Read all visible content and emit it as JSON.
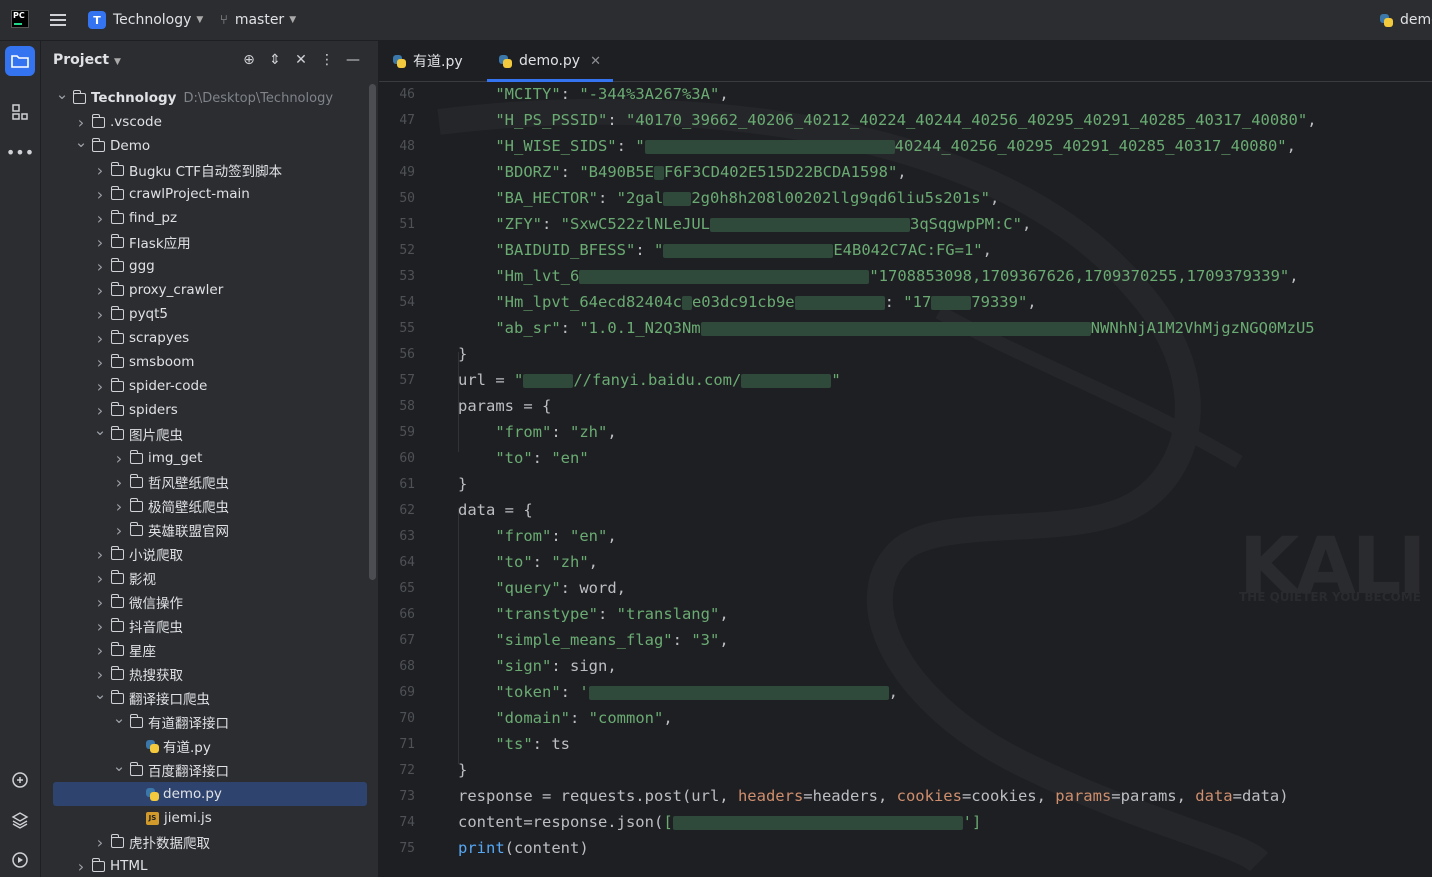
{
  "titlebar": {
    "project_initial": "T",
    "project_name": "Technology",
    "branch": "master",
    "run_config": "demo"
  },
  "panel": {
    "title": "Project",
    "tree": [
      {
        "label": "Technology",
        "path": "D:\\Desktop\\Technology",
        "arrow": "open",
        "depth": 0,
        "type": "folder",
        "bold": true
      },
      {
        "label": ".vscode",
        "arrow": "closed",
        "depth": 1,
        "type": "folder"
      },
      {
        "label": "Demo",
        "arrow": "open",
        "depth": 1,
        "type": "folder"
      },
      {
        "label": "Bugku CTF自动签到脚本",
        "arrow": "closed",
        "depth": 2,
        "type": "folder"
      },
      {
        "label": "crawlProject-main",
        "arrow": "closed",
        "depth": 2,
        "type": "folder"
      },
      {
        "label": "find_pz",
        "arrow": "closed",
        "depth": 2,
        "type": "folder"
      },
      {
        "label": "Flask应用",
        "arrow": "closed",
        "depth": 2,
        "type": "folder"
      },
      {
        "label": "ggg",
        "arrow": "closed",
        "depth": 2,
        "type": "folder"
      },
      {
        "label": "proxy_crawler",
        "arrow": "closed",
        "depth": 2,
        "type": "folder"
      },
      {
        "label": "pyqt5",
        "arrow": "closed",
        "depth": 2,
        "type": "folder"
      },
      {
        "label": "scrapyes",
        "arrow": "closed",
        "depth": 2,
        "type": "folder"
      },
      {
        "label": "smsboom",
        "arrow": "closed",
        "depth": 2,
        "type": "folder"
      },
      {
        "label": "spider-code",
        "arrow": "closed",
        "depth": 2,
        "type": "folder"
      },
      {
        "label": "spiders",
        "arrow": "closed",
        "depth": 2,
        "type": "folder"
      },
      {
        "label": "图片爬虫",
        "arrow": "open",
        "depth": 2,
        "type": "folder"
      },
      {
        "label": "img_get",
        "arrow": "closed",
        "depth": 3,
        "type": "folder"
      },
      {
        "label": "哲风壁纸爬虫",
        "arrow": "closed",
        "depth": 3,
        "type": "folder"
      },
      {
        "label": "极简壁纸爬虫",
        "arrow": "closed",
        "depth": 3,
        "type": "folder"
      },
      {
        "label": "英雄联盟官网",
        "arrow": "closed",
        "depth": 3,
        "type": "folder"
      },
      {
        "label": "小说爬取",
        "arrow": "closed",
        "depth": 2,
        "type": "folder"
      },
      {
        "label": "影视",
        "arrow": "closed",
        "depth": 2,
        "type": "folder"
      },
      {
        "label": "微信操作",
        "arrow": "closed",
        "depth": 2,
        "type": "folder"
      },
      {
        "label": "抖音爬虫",
        "arrow": "closed",
        "depth": 2,
        "type": "folder"
      },
      {
        "label": "星座",
        "arrow": "closed",
        "depth": 2,
        "type": "folder"
      },
      {
        "label": "热搜获取",
        "arrow": "closed",
        "depth": 2,
        "type": "folder"
      },
      {
        "label": "翻译接口爬虫",
        "arrow": "open",
        "depth": 2,
        "type": "folder"
      },
      {
        "label": "有道翻译接口",
        "arrow": "open",
        "depth": 3,
        "type": "folder"
      },
      {
        "label": "有道.py",
        "arrow": "none",
        "depth": 4,
        "type": "py"
      },
      {
        "label": "百度翻译接口",
        "arrow": "open",
        "depth": 3,
        "type": "folder"
      },
      {
        "label": "demo.py",
        "arrow": "none",
        "depth": 4,
        "type": "py",
        "selected": true
      },
      {
        "label": "jiemi.js",
        "arrow": "none",
        "depth": 4,
        "type": "js"
      },
      {
        "label": "虎扑数据爬取",
        "arrow": "closed",
        "depth": 2,
        "type": "folder"
      },
      {
        "label": "HTML",
        "arrow": "closed",
        "depth": 1,
        "type": "folder"
      }
    ]
  },
  "tabs": [
    {
      "label": "有道.py",
      "active": false
    },
    {
      "label": "demo.py",
      "active": true
    }
  ],
  "watermark": {
    "logo": "KALI",
    "tagline": "THE QUIETER YOU BECOME"
  },
  "code": [
    {
      "n": "46",
      "html": "    <span class='s'>\"MCITY\"</span>: <span class='s'>\"-344%3A267%3A\"</span>,"
    },
    {
      "n": "47",
      "html": "    <span class='s'>\"H_PS_PSSID\"</span>: <span class='s'>\"40170_39662_40206_40212_40224_40244_40256_40295_40291_40285_40317_40080\"</span>,"
    },
    {
      "n": "48",
      "html": "    <span class='s'>\"H_WISE_SIDS\"</span>: <span class='s'>\"</span><span class='blur' style='width:250px'></span><span class='s'>40244_40256_40295_40291_40285_40317_40080\"</span>,"
    },
    {
      "n": "49",
      "html": "    <span class='s'>\"BDORZ\"</span>: <span class='s'>\"B490B5E</span><span class='blur' style='width:10px'></span><span class='s'>F6F3CD402E515D22BCDA1598\"</span>,"
    },
    {
      "n": "50",
      "html": "    <span class='s'>\"BA_HECTOR\"</span>: <span class='s'>\"2gal</span><span class='blur' style='width:28px'></span><span class='s'>2g0h8h208l00202llg9qd6liu5s201s\"</span>,"
    },
    {
      "n": "51",
      "html": "    <span class='s'>\"ZFY\"</span>: <span class='s'>\"SxwC522zlNLeJUL</span><span class='blur' style='width:200px'></span><span class='s'>3qSqgwpPM:C\"</span>,"
    },
    {
      "n": "52",
      "html": "    <span class='s'>\"BAIDUID_BFESS\"</span>: <span class='s'>\"</span><span class='blur' style='width:170px'></span><span class='s'>E4B042C7AC:FG=1\"</span>,"
    },
    {
      "n": "53",
      "html": "    <span class='s'>\"Hm_lvt_6</span><span class='blur' style='width:290px'></span><span class='s'>\"1708853098,1709367626,1709370255,1709379339\"</span>,"
    },
    {
      "n": "54",
      "html": "    <span class='s'>\"Hm_lpvt_64ecd82404c</span><span class='blur' style='width:10px'></span><span class='s'>e03dc91cb9e</span><span class='blur' style='width:90px'></span>: <span class='s'>\"17</span><span class='blur' style='width:40px'></span><span class='s'>79339\"</span>,"
    },
    {
      "n": "55",
      "html": "    <span class='s'>\"ab_sr\"</span>: <span class='s'>\"1.0.1_N2Q3Nm</span><span class='blur' style='width:390px'></span><span class='s'>NWNhNjA1M2VhMjgzNGQ0MzU5</span>"
    },
    {
      "n": "56",
      "html": "}"
    },
    {
      "n": "57",
      "html": "url = <span class='s'>\"</span><span class='blur' style='width:50px'></span><span class='s'>//fanyi.baidu.com/</span><span class='blur' style='width:90px'></span><span class='s'>\"</span>"
    },
    {
      "n": "58",
      "html": "params = {"
    },
    {
      "n": "59",
      "html": "    <span class='s'>\"from\"</span>: <span class='s'>\"zh\"</span>,"
    },
    {
      "n": "60",
      "html": "    <span class='s'>\"to\"</span>: <span class='s'>\"en\"</span>"
    },
    {
      "n": "61",
      "html": "}"
    },
    {
      "n": "62",
      "html": "data = {"
    },
    {
      "n": "63",
      "html": "    <span class='s'>\"from\"</span>: <span class='s'>\"en\"</span>,"
    },
    {
      "n": "64",
      "html": "    <span class='s'>\"to\"</span>: <span class='s'>\"zh\"</span>,"
    },
    {
      "n": "65",
      "html": "    <span class='s'>\"query\"</span>: word,"
    },
    {
      "n": "66",
      "html": "    <span class='s'>\"transtype\"</span>: <span class='s'>\"translang\"</span>,"
    },
    {
      "n": "67",
      "html": "    <span class='s'>\"simple_means_flag\"</span>: <span class='s'>\"3\"</span>,"
    },
    {
      "n": "68",
      "html": "    <span class='s'>\"sign\"</span>: sign,"
    },
    {
      "n": "69",
      "html": "    <span class='s'>\"token\"</span>: <span class='s'>'</span><span class='blur' style='width:300px'></span>,"
    },
    {
      "n": "70",
      "html": "    <span class='s'>\"domain\"</span>: <span class='s'>\"common\"</span>,"
    },
    {
      "n": "71",
      "html": "    <span class='s'>\"ts\"</span>: ts"
    },
    {
      "n": "72",
      "html": "}"
    },
    {
      "n": "73",
      "html": "response = requests.post(url, <span class='kw'>headers</span>=headers, <span class='kw'>cookies</span>=cookies, <span class='kw'>params</span>=params, <span class='kw'>data</span>=data)"
    },
    {
      "n": "74",
      "html": "content=response.json(<span class='s'>[</span><span class='blur' style='width:290px'></span><span class='s'>']</span>"
    },
    {
      "n": "75",
      "html": "<span class='fn'>print</span>(content)"
    }
  ],
  "colors": {
    "accent": "#3574f0",
    "string": "#6aab73",
    "keyword_arg": "#cf8e6d",
    "builtin": "#56a8f5"
  }
}
